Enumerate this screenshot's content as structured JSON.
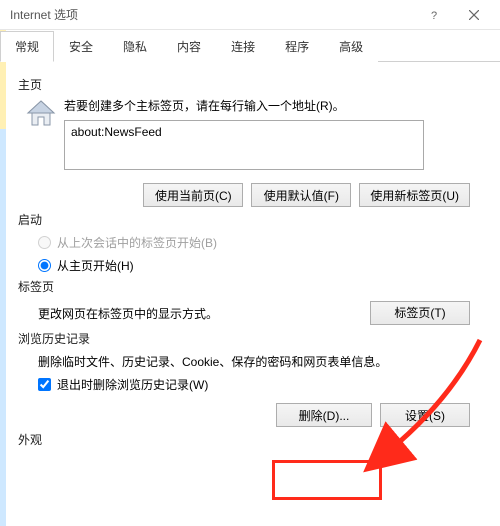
{
  "window": {
    "title": "Internet 选项"
  },
  "tabs": {
    "general": "常规",
    "security": "安全",
    "privacy": "隐私",
    "content": "内容",
    "connections": "连接",
    "programs": "程序",
    "advanced": "高级"
  },
  "homepage": {
    "section_label": "主页",
    "hint": "若要创建多个主标签页，请在每行输入一个地址(R)。",
    "value": "about:NewsFeed",
    "use_current": "使用当前页(C)",
    "use_default": "使用默认值(F)",
    "use_new_tab": "使用新标签页(U)"
  },
  "startup": {
    "section_label": "启动",
    "from_last_session": "从上次会话中的标签页开始(B)",
    "from_homepage": "从主页开始(H)"
  },
  "tabs_section": {
    "section_label": "标签页",
    "desc": "更改网页在标签页中的显示方式。",
    "button": "标签页(T)"
  },
  "history": {
    "section_label": "浏览历史记录",
    "desc": "删除临时文件、历史记录、Cookie、保存的密码和网页表单信息。",
    "delete_on_exit": "退出时删除浏览历史记录(W)",
    "delete_btn": "删除(D)...",
    "settings_btn": "设置(S)"
  },
  "appearance": {
    "section_label": "外观"
  }
}
